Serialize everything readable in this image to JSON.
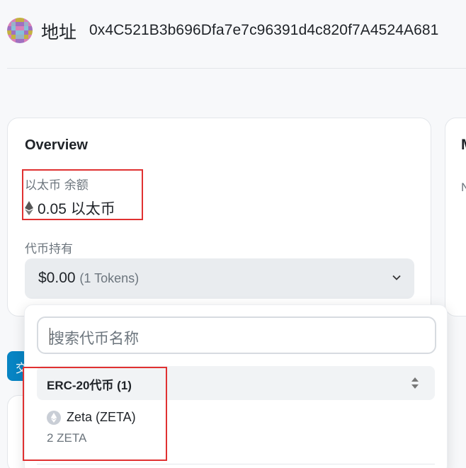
{
  "header": {
    "title": "地址",
    "address": "0x4C521B3b696Dfa7e7c96391d4c820f7A4524A681",
    "avatar_icon": "identicon-avatar"
  },
  "overview": {
    "title": "Overview",
    "eth_label": "以太币 余额",
    "eth_value": "0.05 以太币",
    "eth_icon": "ethereum-icon",
    "token_label": "代币持有",
    "token_total": "$0.00",
    "token_count": "(1 Tokens)"
  },
  "side_card": {
    "letter1": "M",
    "letter2": "N"
  },
  "dropdown": {
    "search_placeholder": "搜索代币名称",
    "group_label": "ERC-20代币 (1)",
    "tokens": [
      {
        "name": "Zeta (ZETA)",
        "amount": "2 ZETA",
        "icon": "ethereum-icon"
      }
    ]
  },
  "tab_peek": "交",
  "colors": {
    "accent": "#0784c3",
    "highlight_box": "#e03131",
    "muted_text": "#6c757d"
  }
}
